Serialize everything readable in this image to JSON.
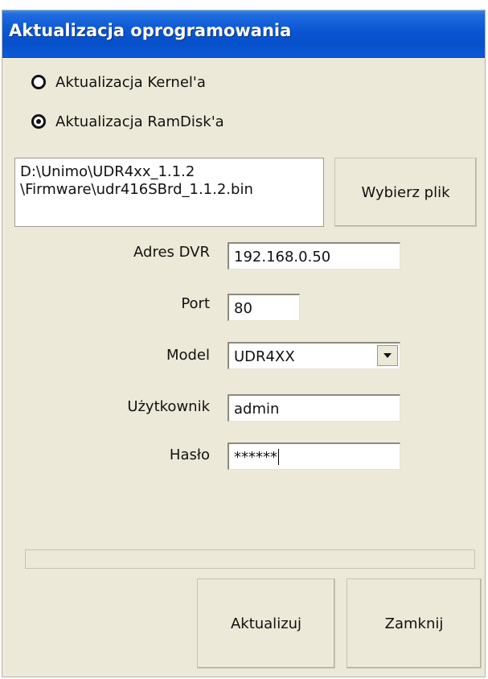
{
  "window": {
    "title": "Aktualizacja oprogramowania"
  },
  "update_type": {
    "options": [
      {
        "label": "Aktualizacja Kernel'a",
        "selected": false
      },
      {
        "label": "Aktualizacja RamDisk'a",
        "selected": true
      }
    ]
  },
  "file": {
    "path_line1": "D:\\Unimo\\UDR4xx_1.1.2",
    "path_line2": "\\Firmware\\udr416SBrd_1.1.2.bin",
    "choose_label": "Wybierz plik"
  },
  "form": {
    "address_label": "Adres DVR",
    "address_value": "192.168.0.50",
    "port_label": "Port",
    "port_value": "80",
    "model_label": "Model",
    "model_value": "UDR4XX",
    "user_label": "Użytkownik",
    "user_value": "admin",
    "password_label": "Hasło",
    "password_value": "******"
  },
  "progress": {
    "value": 0
  },
  "actions": {
    "update_label": "Aktualizuj",
    "close_label": "Zamknij"
  }
}
